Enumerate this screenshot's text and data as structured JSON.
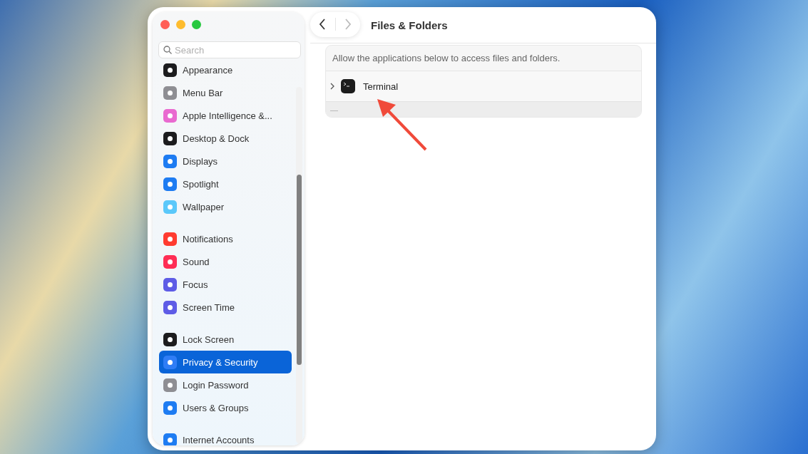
{
  "window": {
    "title": "Files & Folders"
  },
  "sidebar": {
    "search": {
      "placeholder": "Search"
    },
    "groups": [
      [
        {
          "label": "Appearance",
          "color": "#1c1c1e",
          "selected": false
        },
        {
          "label": "Menu Bar",
          "color": "#8e8e93",
          "selected": false
        },
        {
          "label": "Apple Intelligence &...",
          "color": "#e96ad0",
          "selected": false
        },
        {
          "label": "Desktop & Dock",
          "color": "#1c1c1e",
          "selected": false
        },
        {
          "label": "Displays",
          "color": "#1e7cf2",
          "selected": false
        },
        {
          "label": "Spotlight",
          "color": "#1e7cf2",
          "selected": false
        },
        {
          "label": "Wallpaper",
          "color": "#5ac8fa",
          "selected": false
        }
      ],
      [
        {
          "label": "Notifications",
          "color": "#ff3b30",
          "selected": false
        },
        {
          "label": "Sound",
          "color": "#ff2d55",
          "selected": false
        },
        {
          "label": "Focus",
          "color": "#5e5ce6",
          "selected": false
        },
        {
          "label": "Screen Time",
          "color": "#5e5ce6",
          "selected": false
        }
      ],
      [
        {
          "label": "Lock Screen",
          "color": "#1c1c1e",
          "selected": false
        },
        {
          "label": "Privacy & Security",
          "color": "#2f7df6",
          "selected": true
        },
        {
          "label": "Login Password",
          "color": "#8e8e93",
          "selected": false
        },
        {
          "label": "Users & Groups",
          "color": "#1e7cf2",
          "selected": false
        }
      ],
      [
        {
          "label": "Internet Accounts",
          "color": "#1e7cf2",
          "selected": false
        }
      ]
    ]
  },
  "panel": {
    "description": "Allow the applications below to access files and folders.",
    "apps": [
      {
        "name": "Terminal",
        "expanded": false
      }
    ],
    "remove_button": "—"
  }
}
